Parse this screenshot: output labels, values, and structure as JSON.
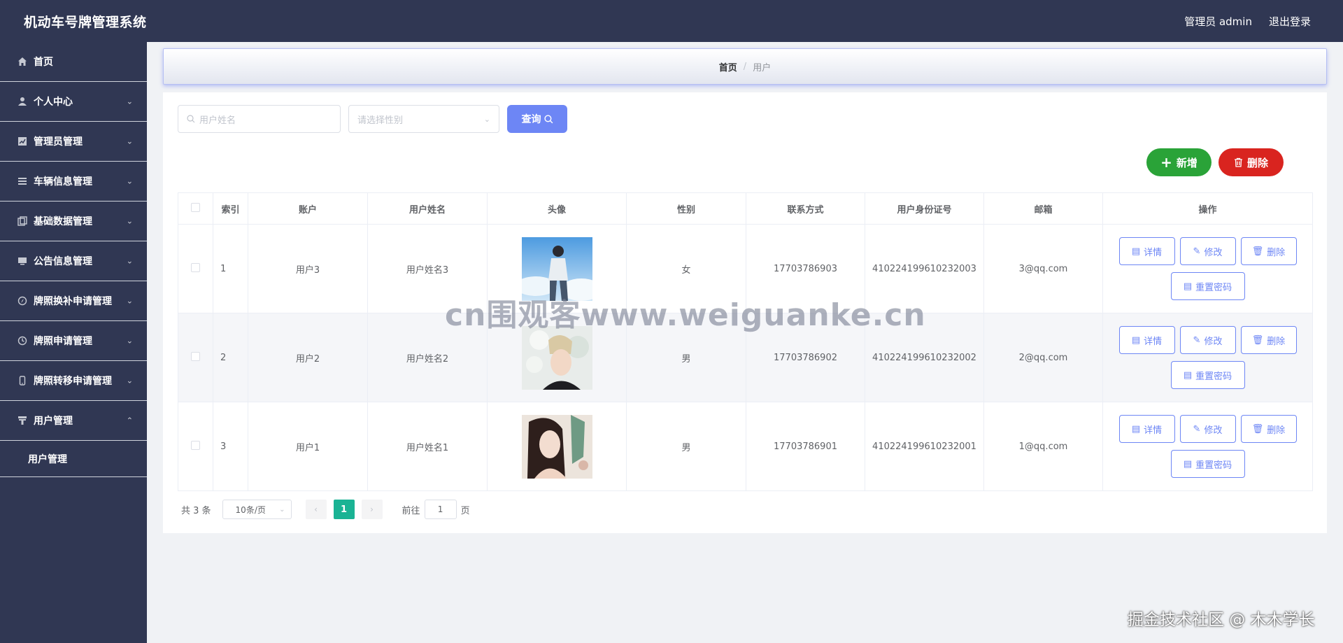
{
  "header": {
    "title": "机动车号牌管理系统",
    "admin_label": "管理员 admin",
    "logout_label": "退出登录"
  },
  "sidebar": {
    "items": [
      {
        "label": "首页",
        "icon": "home-icon",
        "has_arrow": false
      },
      {
        "label": "个人中心",
        "icon": "user-icon",
        "has_arrow": true
      },
      {
        "label": "管理员管理",
        "icon": "chart-icon",
        "has_arrow": true
      },
      {
        "label": "车辆信息管理",
        "icon": "list-icon",
        "has_arrow": true
      },
      {
        "label": "基础数据管理",
        "icon": "copy-icon",
        "has_arrow": true
      },
      {
        "label": "公告信息管理",
        "icon": "monitor-icon",
        "has_arrow": true
      },
      {
        "label": "牌照换补申请管理",
        "icon": "compass-icon",
        "has_arrow": true
      },
      {
        "label": "牌照申请管理",
        "icon": "clock-icon",
        "has_arrow": true
      },
      {
        "label": "牌照转移申请管理",
        "icon": "phone-icon",
        "has_arrow": true
      },
      {
        "label": "用户管理",
        "icon": "stamp-icon",
        "has_arrow": true,
        "expanded": true
      }
    ],
    "sub_item": "用户管理"
  },
  "breadcrumb": {
    "home": "首页",
    "separator": "/",
    "current": "用户"
  },
  "search": {
    "name_placeholder": "用户姓名",
    "sex_placeholder": "请选择性别",
    "query_label": "查询"
  },
  "actions": {
    "add_label": "新增",
    "delete_label": "删除"
  },
  "table": {
    "headers": [
      "索引",
      "账户",
      "用户姓名",
      "头像",
      "性别",
      "联系方式",
      "用户身份证号",
      "邮箱",
      "操作"
    ],
    "rows": [
      {
        "index": "1",
        "account": "用户3",
        "name": "用户姓名3",
        "sex": "女",
        "phone": "17703786903",
        "id_card": "410224199610232003",
        "email": "3@qq.com"
      },
      {
        "index": "2",
        "account": "用户2",
        "name": "用户姓名2",
        "sex": "男",
        "phone": "17703786902",
        "id_card": "410224199610232002",
        "email": "2@qq.com"
      },
      {
        "index": "3",
        "account": "用户1",
        "name": "用户姓名1",
        "sex": "男",
        "phone": "17703786901",
        "id_card": "410224199610232001",
        "email": "1@qq.com"
      }
    ],
    "op_labels": {
      "detail": "详情",
      "edit": "修改",
      "delete": "删除",
      "reset": "重置密码"
    }
  },
  "pagination": {
    "total": "共 3 条",
    "page_size": "10条/页",
    "current_page": "1",
    "goto_label": "前往",
    "goto_value": "1",
    "page_suffix": "页"
  },
  "watermarks": {
    "center": "cn围观客www.weiguanke.cn",
    "corner": "掘金技术社区 @ 木木学长"
  },
  "colors": {
    "header_bg": "#303753",
    "accent": "#6d86f5",
    "add_green": "#2aa338",
    "delete_red": "#d9241f",
    "page_active": "#1ab394"
  }
}
